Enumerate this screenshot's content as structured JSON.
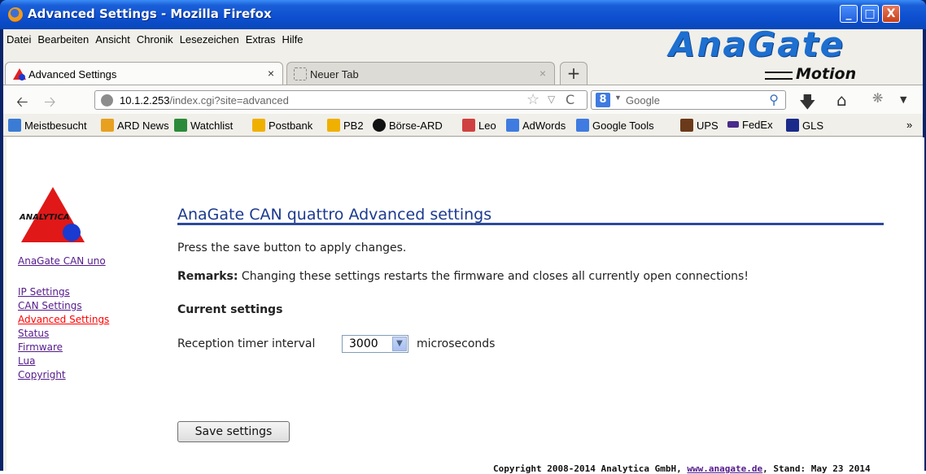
{
  "window": {
    "title": "Advanced Settings - Mozilla Firefox",
    "controls": {
      "minimize": "_",
      "maximize": "□",
      "close": "X"
    }
  },
  "menu": [
    "Datei",
    "Bearbeiten",
    "Ansicht",
    "Chronik",
    "Lesezeichen",
    "Extras",
    "Hilfe"
  ],
  "logo": {
    "main": "AnaGate",
    "sub": "Motion"
  },
  "tabs": [
    {
      "label": "Advanced Settings",
      "active": true
    },
    {
      "label": "Neuer Tab",
      "active": false
    }
  ],
  "tab_close": "×",
  "new_tab": "+",
  "urlbar": {
    "host": "10.1.2.253",
    "path": "/index.cgi?site=advanced"
  },
  "searchbar": {
    "placeholder": "Google",
    "engine": "8"
  },
  "bookmarks": [
    {
      "label": "Meistbesucht",
      "icon_color": "#3a7bd5"
    },
    {
      "label": "ARD News",
      "icon_color": "#e8a020"
    },
    {
      "label": "Watchlist",
      "icon_color": "#2a8a3a"
    },
    {
      "label": "Postbank",
      "icon_color": "#f0b000"
    },
    {
      "label": "PB2",
      "icon_color": "#f0b000"
    },
    {
      "label": "Börse-ARD",
      "icon_color": "#111111"
    },
    {
      "label": "Leo",
      "icon_color": "#d04040"
    },
    {
      "label": "AdWords",
      "icon_color": "#3f7be0"
    },
    {
      "label": "Google Tools",
      "icon_color": "#3f7be0"
    },
    {
      "label": "UPS",
      "icon_color": "#6b3a1a"
    },
    {
      "label": "FedEx",
      "icon_color": "#4a2a8a"
    },
    {
      "label": "GLS",
      "icon_color": "#1a2a8a"
    }
  ],
  "bookmarks_more": "»",
  "sidebar": {
    "logo_text": "ANALYTICA",
    "product_link": "AnaGate CAN uno",
    "links": [
      {
        "label": "IP Settings",
        "current": false
      },
      {
        "label": "CAN Settings",
        "current": false
      },
      {
        "label": "Advanced Settings",
        "current": true
      },
      {
        "label": "Status",
        "current": false
      },
      {
        "label": "Firmware",
        "current": false
      },
      {
        "label": "Lua",
        "current": false
      },
      {
        "label": "Copyright",
        "current": false
      }
    ]
  },
  "main": {
    "title": "AnaGate CAN quattro Advanced settings",
    "instruction": "Press the save button to apply changes.",
    "remarks_label": "Remarks:",
    "remarks_text": " Changing these settings restarts the firmware and closes all currently open connections!",
    "section_heading": "Current settings",
    "timer_label": "Reception timer interval",
    "timer_value": "3000",
    "timer_unit": "microseconds",
    "save_label": "Save settings"
  },
  "footer": {
    "prefix": "Copyright 2008-2014 Analytica GmbH, ",
    "link": "www.anagate.de",
    "suffix": ", Stand: May 23 2014"
  }
}
